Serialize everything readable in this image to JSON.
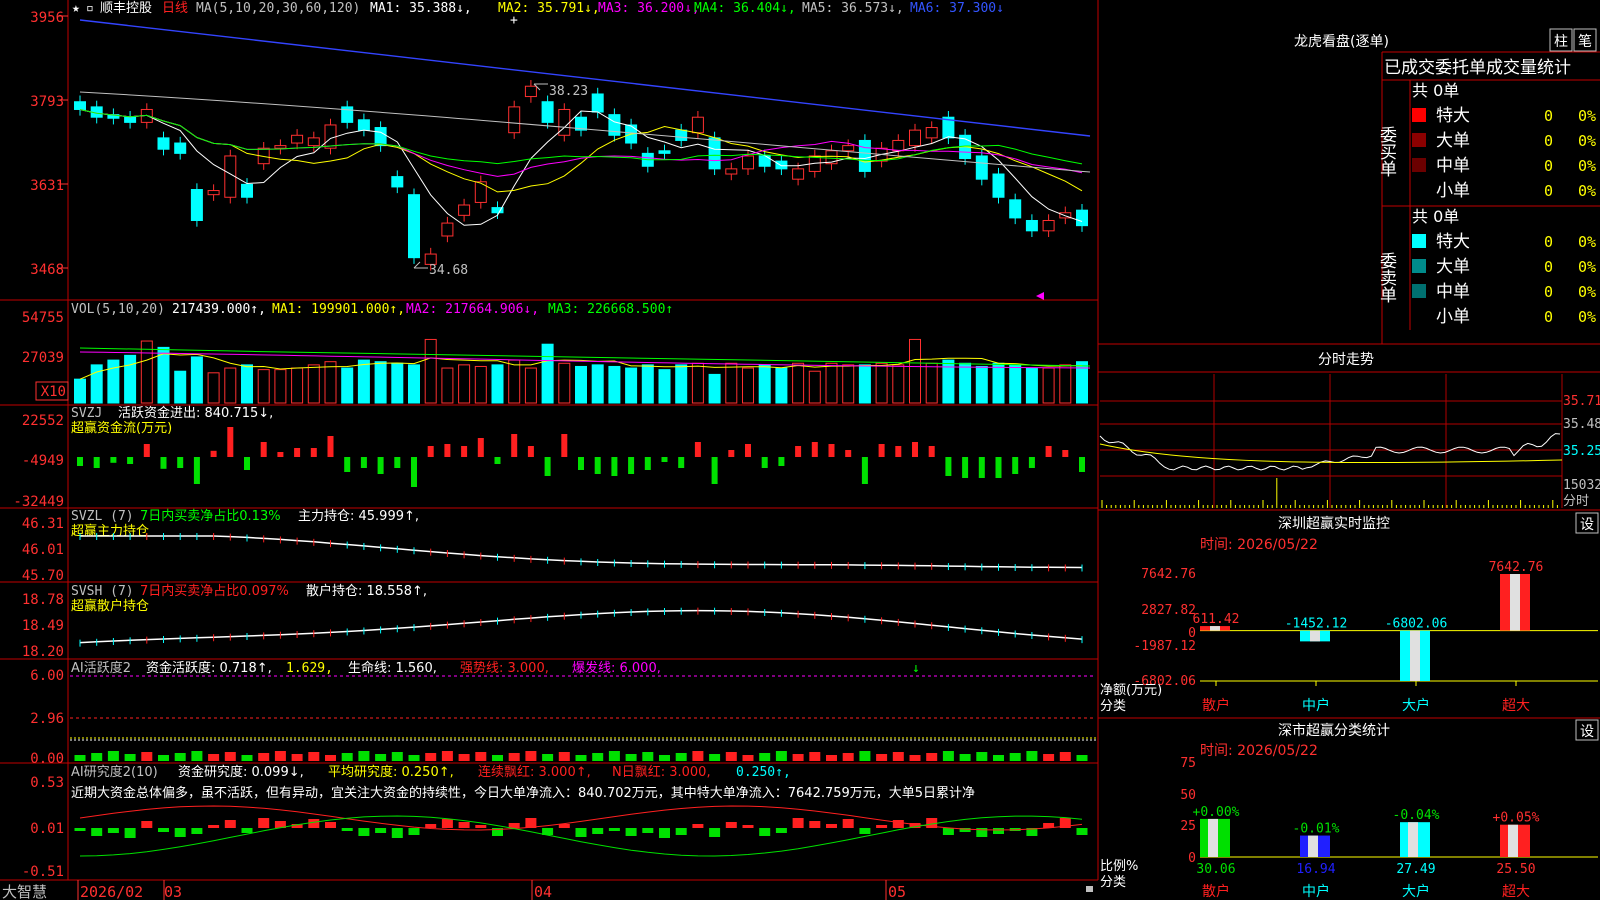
{
  "colors": {
    "red": "#ff2020",
    "cyan": "#00ffff",
    "green": "#00e000",
    "yellow": "#ffff00",
    "magenta": "#ff00ff",
    "blue": "#3333ff",
    "white": "#ffffff",
    "grid": "#b00000",
    "axis": "#ff3030"
  },
  "header": {
    "star": "★",
    "cursor": "▫",
    "stock": "顺丰控股",
    "period": "日线",
    "ma_label": "MA(5,10,20,30,60,120)",
    "ma1": "MA1: 35.388↓,",
    "ma2": "MA2: 35.791↓,",
    "ma3": "MA3: 36.200↓,",
    "ma4": "MA4: 36.404↓,",
    "ma5": "MA5: 36.573↓,",
    "ma6": "MA6: 37.300↓"
  },
  "price_axis": [
    "3956",
    "3793",
    "3631",
    "3468"
  ],
  "price_annotations": {
    "high": "38.23",
    "low": "34.68"
  },
  "vol": {
    "label": "VOL(5,10,20)",
    "val": "217439.000↑,",
    "ma1": "MA1: 199901.000↑,",
    "ma2": "MA2: 217664.906↓,",
    "ma3": "MA3: 226668.500↑",
    "axis": [
      "54755",
      "27039"
    ],
    "unit": "X10"
  },
  "svzj": {
    "label": "SVZJ",
    "text": "活跃资金进出: 840.715↓,",
    "sub": "超赢资金流(万元)",
    "axis": [
      "22552",
      "-4949",
      "-32449"
    ]
  },
  "svzl": {
    "label": "SVZL (7)",
    "text1": "7日内买卖净占比0.13%",
    "text2": "主力持仓: 45.999↑,",
    "sub": "超赢主力持仓",
    "axis": [
      "46.31",
      "46.01",
      "45.70"
    ]
  },
  "svsh": {
    "label": "SVSH (7)",
    "text1": "7日内买卖净占比0.097%",
    "text2": "散户持仓: 18.558↑,",
    "sub": "超赢散户持仓",
    "axis": [
      "18.78",
      "18.49",
      "18.20"
    ]
  },
  "ai1": {
    "label": "AI活跃度2",
    "t1": "资金活跃度: 0.718↑,",
    "t2": "1.629,",
    "t3": "生命线: 1.560,",
    "t4": "强势线: 3.000,",
    "t5": "爆发线: 6.000,",
    "axis": [
      "6.00",
      "2.96",
      "0.00"
    ]
  },
  "ai2": {
    "label": "AI研究度2(10)",
    "t1": "资金研究度: 0.099↓,",
    "t2": "平均研究度: 0.250↑,",
    "t3": "连续飘红: 3.000↑,",
    "t4": "N日飘红: 3.000,",
    "t5": "0.250↑,",
    "note": "近期大资金总体偏多，虽不活跃，但有异动，宜关注大资金的持续性，今日大单净流入：840.702万元，其中特大单净流入：7642.759万元，大单5日累计净",
    "axis": [
      "0.53",
      "0.01",
      "-0.51"
    ]
  },
  "footer": {
    "brand": "大智慧",
    "dates": [
      "2026/02",
      "03",
      "04",
      "05"
    ]
  },
  "right": {
    "lhkp_title": "龙虎看盘(逐单)",
    "tab1": "柱",
    "tab2": "笔",
    "stats_title": "已成交委托单成交量统计",
    "buy_label": "委买单",
    "sell_label": "委卖单",
    "buy_total": "共 0单",
    "sell_total": "共 0单",
    "rows": [
      {
        "name": "特大",
        "count": "0",
        "pct": "0%"
      },
      {
        "name": "大单",
        "count": "0",
        "pct": "0%"
      },
      {
        "name": "中单",
        "count": "0",
        "pct": "0%"
      },
      {
        "name": "小单",
        "count": "0",
        "pct": "0%"
      }
    ],
    "buy_colors": [
      "#ff0000",
      "#8b0000",
      "#6b0000",
      ""
    ],
    "sell_colors": [
      "#00ffff",
      "#008b8b",
      "#007070",
      ""
    ],
    "intraday_title": "分时走势",
    "intraday_axis": [
      "35.71",
      "35.48",
      "35.25",
      "15032",
      "分时"
    ],
    "sz_title": "深圳超赢实时监控",
    "sz_settings": "设",
    "sz_time": "时间: 2026/05/22",
    "sz_axis": [
      "7642.76",
      "2827.82",
      "0",
      "-1987.12",
      "-6802.06"
    ],
    "sz_unit1": "净额(万元)",
    "sz_unit2": "分类",
    "sz_values": [
      611.42,
      -1452.12,
      -6802.06,
      7642.76
    ],
    "sz_labels": [
      "611.42",
      "-1452.12",
      "-6802.06",
      "7642.76"
    ],
    "sz_cats": [
      "散户",
      "中户",
      "大户",
      "超大"
    ],
    "sz_cat_colors": [
      "#ff2020",
      "#00ffff",
      "#00ffff",
      "#ff2020"
    ],
    "sc_title": "深市超赢分类统计",
    "sc_settings": "设",
    "sc_time": "时间: 2026/05/22",
    "sc_axis": [
      "75",
      "50",
      "25",
      "0"
    ],
    "sc_unit1": "比例%",
    "sc_unit2": "分类",
    "sc_values": [
      30.06,
      16.94,
      27.49,
      25.5
    ],
    "sc_vals_text": [
      "30.06",
      "16.94",
      "27.49",
      "25.50"
    ],
    "sc_delta": [
      "+0.00%",
      "-0.01%",
      "-0.04%",
      "+0.05%"
    ],
    "sc_colors": [
      "#00e000",
      "#2020ff",
      "#00ffff",
      "#ff2020"
    ],
    "sc_cats": [
      "散户",
      "中户",
      "大户",
      "超大"
    ]
  },
  "chart_data": {
    "type": "candlestick",
    "candles": [
      {
        "o": 37.9,
        "c": 37.75
      },
      {
        "o": 37.8,
        "c": 37.6
      },
      {
        "o": 37.65,
        "c": 37.58
      },
      {
        "o": 37.6,
        "c": 37.5
      },
      {
        "o": 37.5,
        "c": 37.75
      },
      {
        "o": 37.2,
        "c": 36.98
      },
      {
        "o": 37.1,
        "c": 36.9
      },
      {
        "o": 36.2,
        "c": 35.6
      },
      {
        "o": 36.1,
        "c": 36.18
      },
      {
        "o": 36.05,
        "c": 36.85
      },
      {
        "o": 36.3,
        "c": 36.05
      },
      {
        "o": 36.7,
        "c": 37.0
      },
      {
        "o": 37.0,
        "c": 37.05
      },
      {
        "o": 37.1,
        "c": 37.25
      },
      {
        "o": 37.05,
        "c": 37.2
      },
      {
        "o": 37.0,
        "c": 37.45
      },
      {
        "o": 37.8,
        "c": 37.5
      },
      {
        "o": 37.55,
        "c": 37.35
      },
      {
        "o": 37.4,
        "c": 37.05
      },
      {
        "o": 36.45,
        "c": 36.25
      },
      {
        "o": 36.1,
        "c": 34.88
      },
      {
        "o": 34.75,
        "c": 34.95
      },
      {
        "o": 35.3,
        "c": 35.55
      },
      {
        "o": 35.7,
        "c": 35.9
      },
      {
        "o": 35.95,
        "c": 36.35
      },
      {
        "o": 35.85,
        "c": 35.75
      },
      {
        "o": 37.3,
        "c": 37.8
      },
      {
        "o": 38.0,
        "c": 38.2
      },
      {
        "o": 37.9,
        "c": 37.5
      },
      {
        "o": 37.25,
        "c": 37.75
      },
      {
        "o": 37.6,
        "c": 37.35
      },
      {
        "o": 38.05,
        "c": 37.7
      },
      {
        "o": 37.65,
        "c": 37.25
      },
      {
        "o": 37.45,
        "c": 37.1
      },
      {
        "o": 36.9,
        "c": 36.65
      },
      {
        "o": 36.95,
        "c": 36.9
      },
      {
        "o": 37.35,
        "c": 37.15
      },
      {
        "o": 37.3,
        "c": 37.6
      },
      {
        "o": 37.2,
        "c": 36.6
      },
      {
        "o": 36.5,
        "c": 36.6
      },
      {
        "o": 36.6,
        "c": 36.85
      },
      {
        "o": 36.85,
        "c": 36.65
      },
      {
        "o": 36.75,
        "c": 36.6
      },
      {
        "o": 36.4,
        "c": 36.6
      },
      {
        "o": 36.55,
        "c": 36.85
      },
      {
        "o": 36.7,
        "c": 36.95
      },
      {
        "o": 36.95,
        "c": 37.05
      },
      {
        "o": 37.15,
        "c": 36.55
      },
      {
        "o": 36.75,
        "c": 37.0
      },
      {
        "o": 36.95,
        "c": 37.15
      },
      {
        "o": 37.05,
        "c": 37.35
      },
      {
        "o": 37.2,
        "c": 37.4
      },
      {
        "o": 37.6,
        "c": 37.2
      },
      {
        "o": 37.25,
        "c": 36.8
      },
      {
        "o": 36.85,
        "c": 36.4
      },
      {
        "o": 36.5,
        "c": 36.05
      },
      {
        "o": 36.0,
        "c": 35.65
      },
      {
        "o": 35.6,
        "c": 35.4
      },
      {
        "o": 35.4,
        "c": 35.6
      },
      {
        "o": 35.65,
        "c": 35.75
      },
      {
        "o": 35.8,
        "c": 35.5
      }
    ],
    "volume": [
      15,
      24,
      27,
      30,
      39,
      35,
      20,
      29,
      19,
      22,
      24,
      21,
      21,
      22,
      24,
      26,
      22,
      27,
      26,
      25,
      24,
      40,
      22,
      24,
      23,
      24,
      27,
      22,
      37,
      25,
      23,
      24,
      23,
      22,
      24,
      21,
      24,
      25,
      18,
      25,
      22,
      24,
      22,
      25,
      20,
      25,
      24,
      24,
      25,
      24,
      40,
      25,
      27,
      25,
      23,
      25,
      24,
      22,
      22,
      24,
      26
    ],
    "x_ticks": [
      "2026/02",
      "03",
      "04",
      "05"
    ]
  }
}
